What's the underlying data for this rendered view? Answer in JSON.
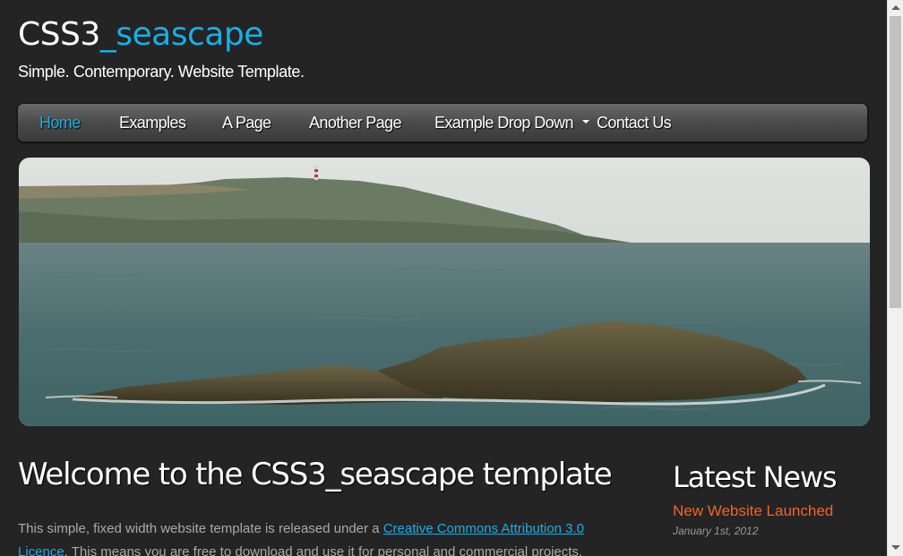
{
  "header": {
    "logo_part1": "CSS3",
    "logo_part2": "_seascape",
    "slogan": "Simple. Contemporary. Website Template."
  },
  "menu": {
    "items": [
      {
        "label": "Home",
        "active": true
      },
      {
        "label": "Examples"
      },
      {
        "label": "A Page"
      },
      {
        "label": "Another Page"
      },
      {
        "label": "Example Drop Down"
      },
      {
        "label": "Contact Us"
      }
    ]
  },
  "main": {
    "title": "Welcome to the CSS3_seascape template",
    "para_before": "This simple, fixed width website template is released under a ",
    "link_text": "Creative Commons Attribution 3.0 Licence",
    "para_after": ". This means you are free to download and use it for personal and commercial projects."
  },
  "sidebar": {
    "title": "Latest News",
    "headline": "New Website Launched",
    "date": "January 1st, 2012"
  },
  "colors": {
    "background": "#242424",
    "accent": "#1aaee5",
    "news": "#f26522"
  }
}
